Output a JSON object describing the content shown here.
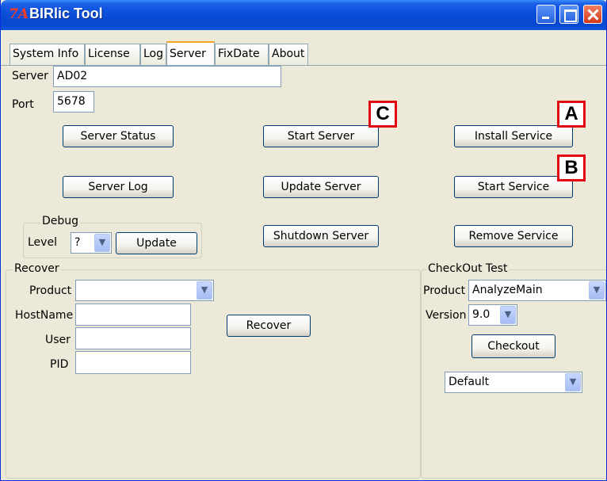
{
  "window": {
    "title": "BIRlic Tool",
    "icon_text": "7A"
  },
  "tabs": [
    "System Info",
    "License",
    "Log",
    "Server",
    "FixDate",
    "About"
  ],
  "active_tab": "Server",
  "server": {
    "server_label": "Server",
    "server_value": "AD02",
    "port_label": "Port",
    "port_value": "5678"
  },
  "buttons": {
    "server_status": "Server Status",
    "server_log": "Server Log",
    "start_server": "Start Server",
    "update_server": "Update Server",
    "shutdown_server": "Shutdown Server",
    "install_service": "Install Service",
    "start_service": "Start Service",
    "remove_service": "Remove Service"
  },
  "debug": {
    "title": "Debug",
    "level_label": "Level",
    "level_value": "?",
    "update_label": "Update"
  },
  "recover": {
    "title": "Recover",
    "product_label": "Product",
    "product_value": "",
    "hostname_label": "HostName",
    "hostname_value": "",
    "user_label": "User",
    "user_value": "",
    "pid_label": "PID",
    "pid_value": "",
    "recover_button": "Recover"
  },
  "checkout": {
    "title": "CheckOut Test",
    "product_label": "Product",
    "product_value": "AnalyzeMain",
    "version_label": "Version",
    "version_value": "9.0",
    "checkout_button": "Checkout",
    "profile_value": "Default"
  },
  "callouts": {
    "a": "A",
    "b": "B",
    "c": "C"
  },
  "colors": {
    "titlebar": "#0a4fd8",
    "callout_border": "#e30613",
    "active_tab_accent": "#f5a623"
  }
}
